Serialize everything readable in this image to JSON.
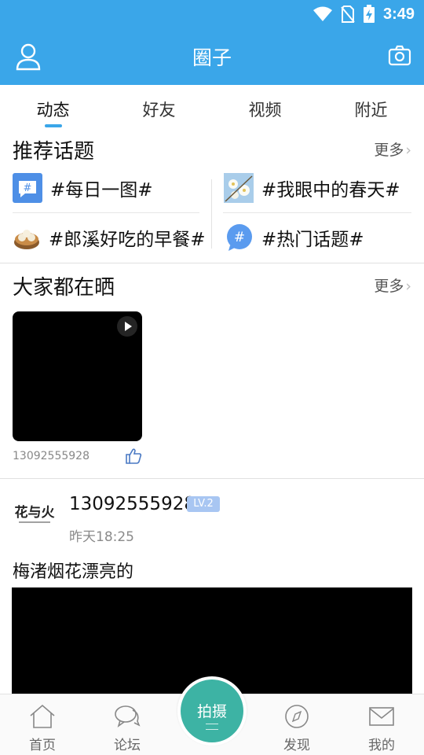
{
  "status_bar": {
    "time": "3:49"
  },
  "header": {
    "title": "圈子"
  },
  "tabs": [
    {
      "label": "动态",
      "active": true
    },
    {
      "label": "好友",
      "active": false
    },
    {
      "label": "视频",
      "active": false
    },
    {
      "label": "附近",
      "active": false
    }
  ],
  "recommended_topics": {
    "title": "推荐话题",
    "more": "更多",
    "items": [
      {
        "label": "#每日一图#",
        "icon": "hashtag-square-icon"
      },
      {
        "label": "#我眼中的春天#",
        "icon": "flowers-thumbnail"
      },
      {
        "label": "#郎溪好吃的早餐#",
        "icon": "dumplings-thumbnail"
      },
      {
        "label": "#热门话题#",
        "icon": "hashtag-bubble-icon"
      }
    ]
  },
  "showcase": {
    "title": "大家都在晒",
    "more": "更多",
    "video": {
      "user": "13092555928"
    }
  },
  "post": {
    "user": "13092555928",
    "level": "LV.2",
    "time": "昨天18:25",
    "text": "梅渚烟花漂亮的",
    "avatar_text": "花与火"
  },
  "bottom_nav": {
    "items": [
      {
        "label": "首页"
      },
      {
        "label": "论坛"
      },
      {
        "label": "发现"
      },
      {
        "label": "我的"
      }
    ],
    "center": {
      "label": "拍摄"
    }
  },
  "colors": {
    "primary": "#3aa6e9",
    "shoot_button": "#3db3a4",
    "level_badge": "#a8c6f2"
  }
}
